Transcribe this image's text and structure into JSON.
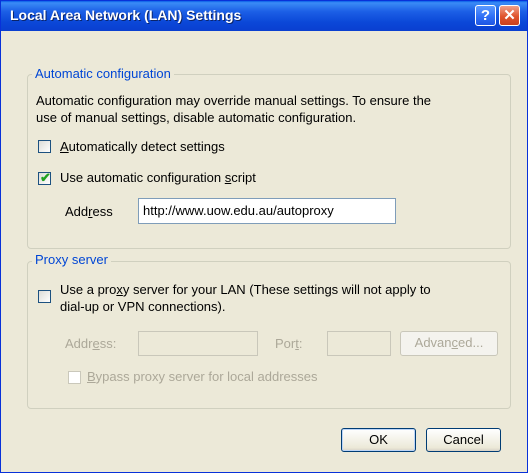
{
  "window": {
    "title": "Local Area Network (LAN) Settings",
    "help_glyph": "?",
    "close_glyph": "✕"
  },
  "auto_config": {
    "legend": "Automatic configuration",
    "description_line1": "Automatic configuration may override manual settings.  To ensure the",
    "description_line2": "use of manual settings, disable automatic configuration.",
    "detect": {
      "label_hotkey": "A",
      "label_rest": "utomatically detect settings",
      "checked": false
    },
    "script": {
      "label_pre": "Use automatic configuration ",
      "label_hotkey": "s",
      "label_rest": "cript",
      "checked": true
    },
    "address": {
      "label_pre": "Add",
      "label_hotkey": "r",
      "label_rest": "ess",
      "value": "http://www.uow.edu.au/autoproxy"
    }
  },
  "proxy": {
    "legend": "Proxy server",
    "use_line1": "Use a pro",
    "use_hotkey": "x",
    "use_line1_rest": "y server for your LAN (These settings will not apply to",
    "use_line2": "dial-up or VPN connections).",
    "use_checked": false,
    "address_pre": "Addr",
    "address_hotkey": "e",
    "address_rest": "ss:",
    "port_pre": "Por",
    "port_hotkey": "t",
    "port_rest": ":",
    "advanced_pre": "Advan",
    "advanced_hotkey": "c",
    "advanced_rest": "ed...",
    "bypass_hotkey": "B",
    "bypass_rest": "ypass proxy server for local addresses"
  },
  "buttons": {
    "ok": "OK",
    "cancel": "Cancel"
  }
}
